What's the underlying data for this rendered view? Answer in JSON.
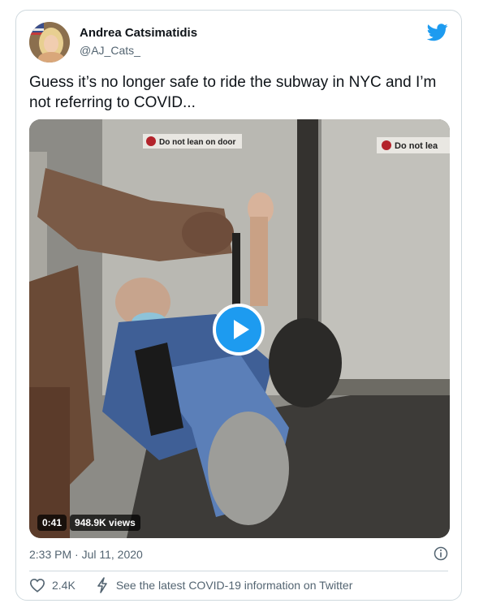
{
  "author": {
    "name": "Andrea Catsimatidis",
    "handle": "@AJ_Cats_"
  },
  "tweet": {
    "text": "Guess it’s no longer safe to ride the subway in NYC and I’m not referring to COVID..."
  },
  "media": {
    "type": "video",
    "duration": "0:41",
    "views": "948.9K views",
    "signs": [
      "Do not lean on door",
      "Do not lea"
    ]
  },
  "meta": {
    "timestamp": "2:33 PM · Jul 11, 2020"
  },
  "actions": {
    "likes": "2.4K",
    "covid_link": "See the latest COVID-19 information on Twitter"
  },
  "icons": {
    "brand": "twitter-bird-icon",
    "play": "play-icon",
    "info": "info-icon",
    "like": "heart-icon",
    "covid": "lightning-icon"
  },
  "colors": {
    "brand": "#1d9bf0",
    "text": "#0f1419",
    "muted": "#536471",
    "border": "#cfd9de"
  }
}
